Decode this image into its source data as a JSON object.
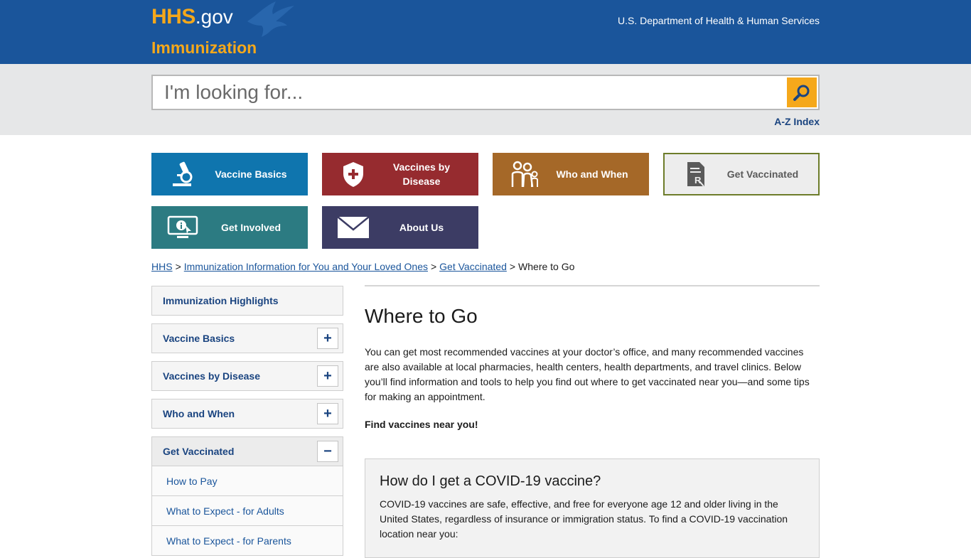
{
  "header": {
    "logo_hhs": "HHS",
    "logo_gov": ".gov",
    "site_name": "Immunization",
    "dept_link": "U.S. Department of Health & Human Services",
    "brand_color": "#1a559b",
    "accent_color": "#f5a81b"
  },
  "search": {
    "placeholder": "I'm looking for...",
    "value": "",
    "button_icon": "search-icon",
    "az_index": "A-Z Index"
  },
  "tiles": [
    {
      "label": "Vaccine Basics",
      "icon": "microscope-icon",
      "color": "#0f75ae"
    },
    {
      "label": "Vaccines by Disease",
      "icon": "shield-cross-icon",
      "color": "#962b2f"
    },
    {
      "label": "Who and When",
      "icon": "family-icon",
      "color": "#a56828"
    },
    {
      "label": "Get Vaccinated",
      "icon": "prescription-icon",
      "color": "#ededed"
    },
    {
      "label": "Get Involved",
      "icon": "monitor-icon",
      "color": "#2c7b82"
    },
    {
      "label": "About Us",
      "icon": "envelope-icon",
      "color": "#3c3c64"
    }
  ],
  "breadcrumb": {
    "items": [
      "HHS",
      "Immunization Information for You and Your Loved Ones",
      "Get Vaccinated"
    ],
    "current": "Where to Go",
    "separator": ">"
  },
  "sidebar": {
    "items": [
      {
        "label": "Immunization Highlights",
        "toggle": ""
      },
      {
        "label": "Vaccine Basics",
        "toggle": "+"
      },
      {
        "label": "Vaccines by Disease",
        "toggle": "+"
      },
      {
        "label": "Who and When",
        "toggle": "+"
      },
      {
        "label": "Get Vaccinated",
        "toggle": "−"
      }
    ],
    "sub_items": [
      "How to Pay",
      "What to Expect - for Adults",
      "What to Expect - for Parents"
    ]
  },
  "main": {
    "title": "Where to Go",
    "intro": "You can get most recommended vaccines at your doctor’s office, and many recommended vaccines are also available at local pharmacies, health centers, health departments, and travel clinics. Below you’ll find information and tools to help you find out where to get vaccinated near you—and some tips for making an appointment.",
    "find_heading": "Find vaccines near you!",
    "covid_box": {
      "title": "How do I get a COVID-19 vaccine?",
      "text": "COVID-19 vaccines are safe, effective, and free for everyone age 12 and older living in the United States, regardless of insurance or immigration status. To find a COVID-19 vaccination location near you:"
    }
  }
}
